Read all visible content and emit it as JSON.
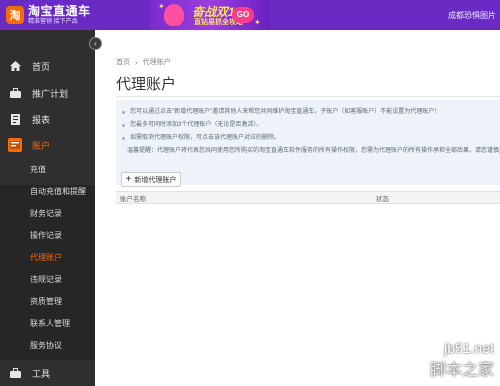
{
  "header": {
    "logo_mark": "淘",
    "logo_title": "淘宝直通车",
    "logo_sub": "精准营销 接下产品",
    "banner_title": "奋战双12",
    "banner_sub": "直钻易抓全攻略",
    "banner_go": "GO",
    "shop_link": "成都恐惧图片"
  },
  "sidebar": {
    "collapse": "‹",
    "items": [
      {
        "label": "首页",
        "icon": "home-icon"
      },
      {
        "label": "推广计划",
        "icon": "briefcase-icon"
      },
      {
        "label": "报表",
        "icon": "report-icon"
      },
      {
        "label": "账户",
        "icon": "account-icon"
      }
    ],
    "sub_items": [
      {
        "label": "充值"
      },
      {
        "label": "自动充值和提醒"
      },
      {
        "label": "财务记录"
      },
      {
        "label": "操作记录"
      },
      {
        "label": "代理账户"
      },
      {
        "label": "违规记录"
      },
      {
        "label": "资质管理"
      },
      {
        "label": "联系人管理"
      },
      {
        "label": "服务协议"
      }
    ],
    "tools": {
      "label": "工具",
      "icon": "tools-icon"
    }
  },
  "main": {
    "breadcrumb": [
      "首页",
      "代理账户"
    ],
    "breadcrumb_sep": "›",
    "title": "代理账户",
    "notices": [
      "您可以通过点击\"新增代理账户\"邀请其他人来帮您共同维护淘宝直通车，子账户（如客服账户）不能设置为代理账户！",
      "您最多可同时添加3个代理账户（无论是否激活）。",
      "如需取消代理账户权限，可点击该代理账户对应的删除。",
      "温馨提醒：代理账户将代表您共同使用您所购买的淘宝直通车软件服务的所有操作权限，您需为代理账户的所有操作承担全部后果，请您谨慎操作！"
    ],
    "add_button": "新增代理账户",
    "add_plus": "+",
    "table_headers": [
      "账户名称",
      "状态"
    ]
  },
  "watermark": {
    "site": "jb51.net",
    "name": "脚本之家"
  },
  "colors": {
    "topbar": "#6a2bc4",
    "sidebar": "#2f2f2f",
    "accent": "#ff6a00"
  }
}
